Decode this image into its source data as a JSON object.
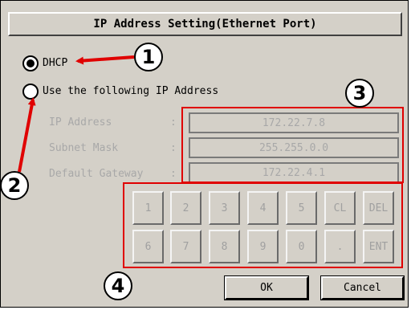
{
  "dialog": {
    "title": "IP Address Setting(Ethernet Port)"
  },
  "network_mode": {
    "dhcp_label": "DHCP",
    "dhcp_selected": true,
    "static_label": "Use the following IP Address",
    "static_selected": false
  },
  "fields": {
    "separator": ":",
    "ip_address": {
      "label": "IP Address",
      "value": "172.22.7.8"
    },
    "subnet_mask": {
      "label": "Subnet Mask",
      "value": "255.255.0.0"
    },
    "default_gateway": {
      "label": "Default Gateway",
      "value": "172.22.4.1"
    }
  },
  "keypad": {
    "row1": [
      "1",
      "2",
      "3",
      "4",
      "5",
      "CL",
      "DEL"
    ],
    "row2": [
      "6",
      "7",
      "8",
      "9",
      "0",
      ".",
      "ENT"
    ]
  },
  "buttons": {
    "ok_label": "OK",
    "cancel_label": "Cancel"
  },
  "callouts": {
    "c1": "1",
    "c2": "2",
    "c3": "3",
    "c4": "4"
  },
  "colors": {
    "dialog_bg": "#d4d0c8",
    "disabled_text": "#a8a8a8",
    "annotation_red": "#e00000"
  }
}
